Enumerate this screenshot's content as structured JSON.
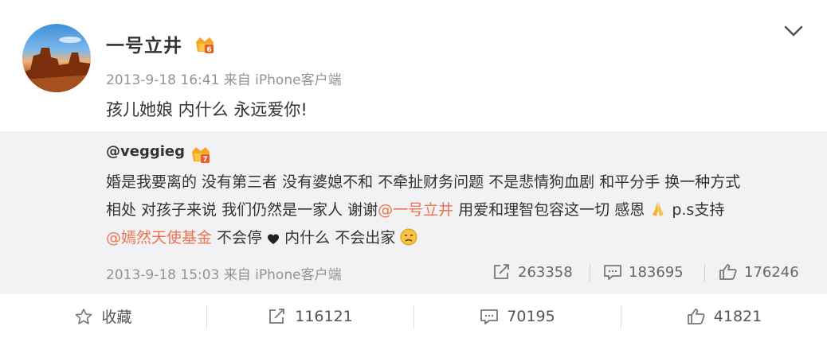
{
  "post": {
    "username": "一号立井",
    "meta": "2013-9-18 16:41 来自 iPhone客户端",
    "text": "孩儿她娘 内什么 永远爱你!",
    "menu_icon": "chevron-down-icon",
    "badge_icon": "crown-vip-icon"
  },
  "repost": {
    "author": "@veggieg",
    "badge_icon": "crown-vip-icon",
    "line1": "婚是我要离的 没有第三者 没有婆媳不和 不牵扯财务问题 不是悲情狗血剧 和平分手 换一种方式",
    "line2_a": "相处 对孩子来说 我们仍然是一家人 谢谢",
    "line2_mention": "@一号立井",
    "line2_b": " 用爱和理智包容这一切 感恩",
    "line2_c": " p.s支持",
    "line3_mention": "@嫣然天使基金",
    "line3_a": " 不会停",
    "line3_b": " 内什么 不会出家",
    "meta": "2013-9-18 15:03 来自 iPhone客户端",
    "stats": {
      "reposts": "263358",
      "comments": "183695",
      "likes": "176246"
    }
  },
  "actions": {
    "favorite_label": "收藏",
    "reposts": "116121",
    "comments": "70195",
    "likes": "41821"
  },
  "colors": {
    "mention": "#eb7350",
    "repost_bg": "#f2f2f5",
    "meta_text": "#939393"
  }
}
